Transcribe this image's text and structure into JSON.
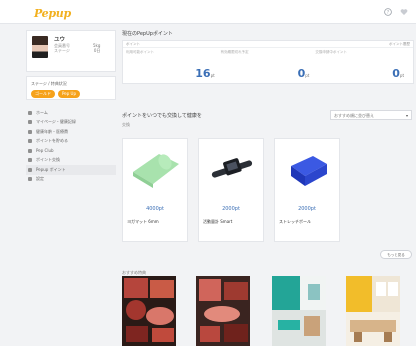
{
  "header": {
    "logo": "Pepup",
    "icons": [
      "question-icon",
      "heart-icon"
    ]
  },
  "profile": {
    "name": "ユウ",
    "meta": [
      "会員番号",
      "ステージ"
    ],
    "stats": [
      "5kg",
      "0日"
    ]
  },
  "stage": {
    "title": "ステージ / 特典状況",
    "pills": [
      "ゴールド",
      "Pep Up"
    ]
  },
  "menu": [
    {
      "label": "ホーム",
      "icon": "home-icon"
    },
    {
      "label": "マイページ・健康記録",
      "icon": "heart-icon"
    },
    {
      "label": "健康年齢・医療費",
      "icon": "chart-icon"
    },
    {
      "label": "ポイントを貯める",
      "icon": "coin-icon"
    },
    {
      "label": "Pep Club",
      "icon": "club-icon"
    },
    {
      "label": "ポイント交換",
      "icon": "gift-icon"
    },
    {
      "label": "Pepup ポイント",
      "icon": "point-icon"
    },
    {
      "label": "設定",
      "icon": "gear-icon"
    }
  ],
  "points": {
    "title": "現在のPepUpポイント",
    "head_left": "ポイント",
    "head_right": "ポイント履歴",
    "cols": [
      {
        "label": "利用可能ポイント",
        "value": "16",
        "unit": "pt"
      },
      {
        "label": "有効期限切れ予定",
        "value": "0",
        "unit": "pt"
      },
      {
        "label": "交換申請中ポイント",
        "value": "0",
        "unit": "pt"
      }
    ]
  },
  "exchange": {
    "title": "ポイントをいつでも交換して健康を",
    "sub": "交換",
    "sort_label": "おすすめ順に並び替え"
  },
  "products": [
    {
      "price": "4000pt",
      "name": "ヨガマット 6mm",
      "kind": "mat"
    },
    {
      "price": "2000pt",
      "name": "活動量計 Smart",
      "kind": "band"
    },
    {
      "price": "2000pt",
      "name": "ストレッチポール",
      "kind": "block"
    }
  ],
  "more_label": "もっと見る",
  "recommend": {
    "title": "おすすめ特典",
    "cards": [
      "meat",
      "meat",
      "room",
      "room"
    ]
  }
}
